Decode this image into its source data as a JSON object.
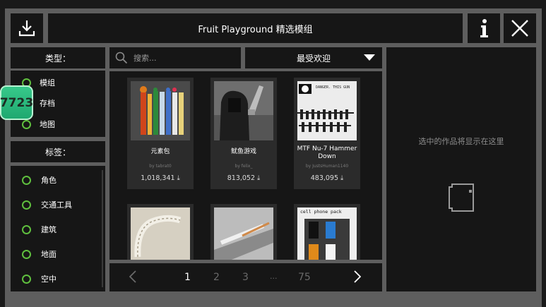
{
  "header": {
    "title": "Fruit Playground 精选模组"
  },
  "sidebar": {
    "type_header": "类型：",
    "types": [
      {
        "label": "模组"
      },
      {
        "label": "存档"
      },
      {
        "label": "地图"
      }
    ],
    "tag_header": "标签：",
    "tags": [
      {
        "label": "角色"
      },
      {
        "label": "交通工具"
      },
      {
        "label": "建筑"
      },
      {
        "label": "地面"
      },
      {
        "label": "空中"
      }
    ]
  },
  "badge": {
    "text": "7723"
  },
  "search": {
    "placeholder": "搜索..."
  },
  "sort": {
    "selected": "最受欢迎"
  },
  "items": [
    {
      "name": "元素包",
      "author": "by tabrat0",
      "downloads": "1,018,341 ⤓"
    },
    {
      "name": "鱿鱼游戏",
      "author": "by felix_",
      "downloads": "813,052 ⤓"
    },
    {
      "name": "MTF Nu-7 Hammer Down",
      "author": "by JustsHuman1140",
      "downloads": "483,095 ⤓"
    },
    {
      "name": "",
      "author": "",
      "downloads": ""
    },
    {
      "name": "",
      "author": "",
      "downloads": ""
    },
    {
      "name": "",
      "author": "",
      "downloads": ""
    }
  ],
  "thumb_text": {
    "mtf": "DANGER. THIS GUN",
    "phone": "cell phone pack"
  },
  "pagination": {
    "pages": [
      "1",
      "2",
      "3",
      "···",
      "75"
    ],
    "current": "1"
  },
  "preview": {
    "placeholder": "选中的作品将显示在这里"
  },
  "colors": {
    "accent_green": "#5fbf3e",
    "frame": "#5e5e5e",
    "panel": "#161616"
  }
}
